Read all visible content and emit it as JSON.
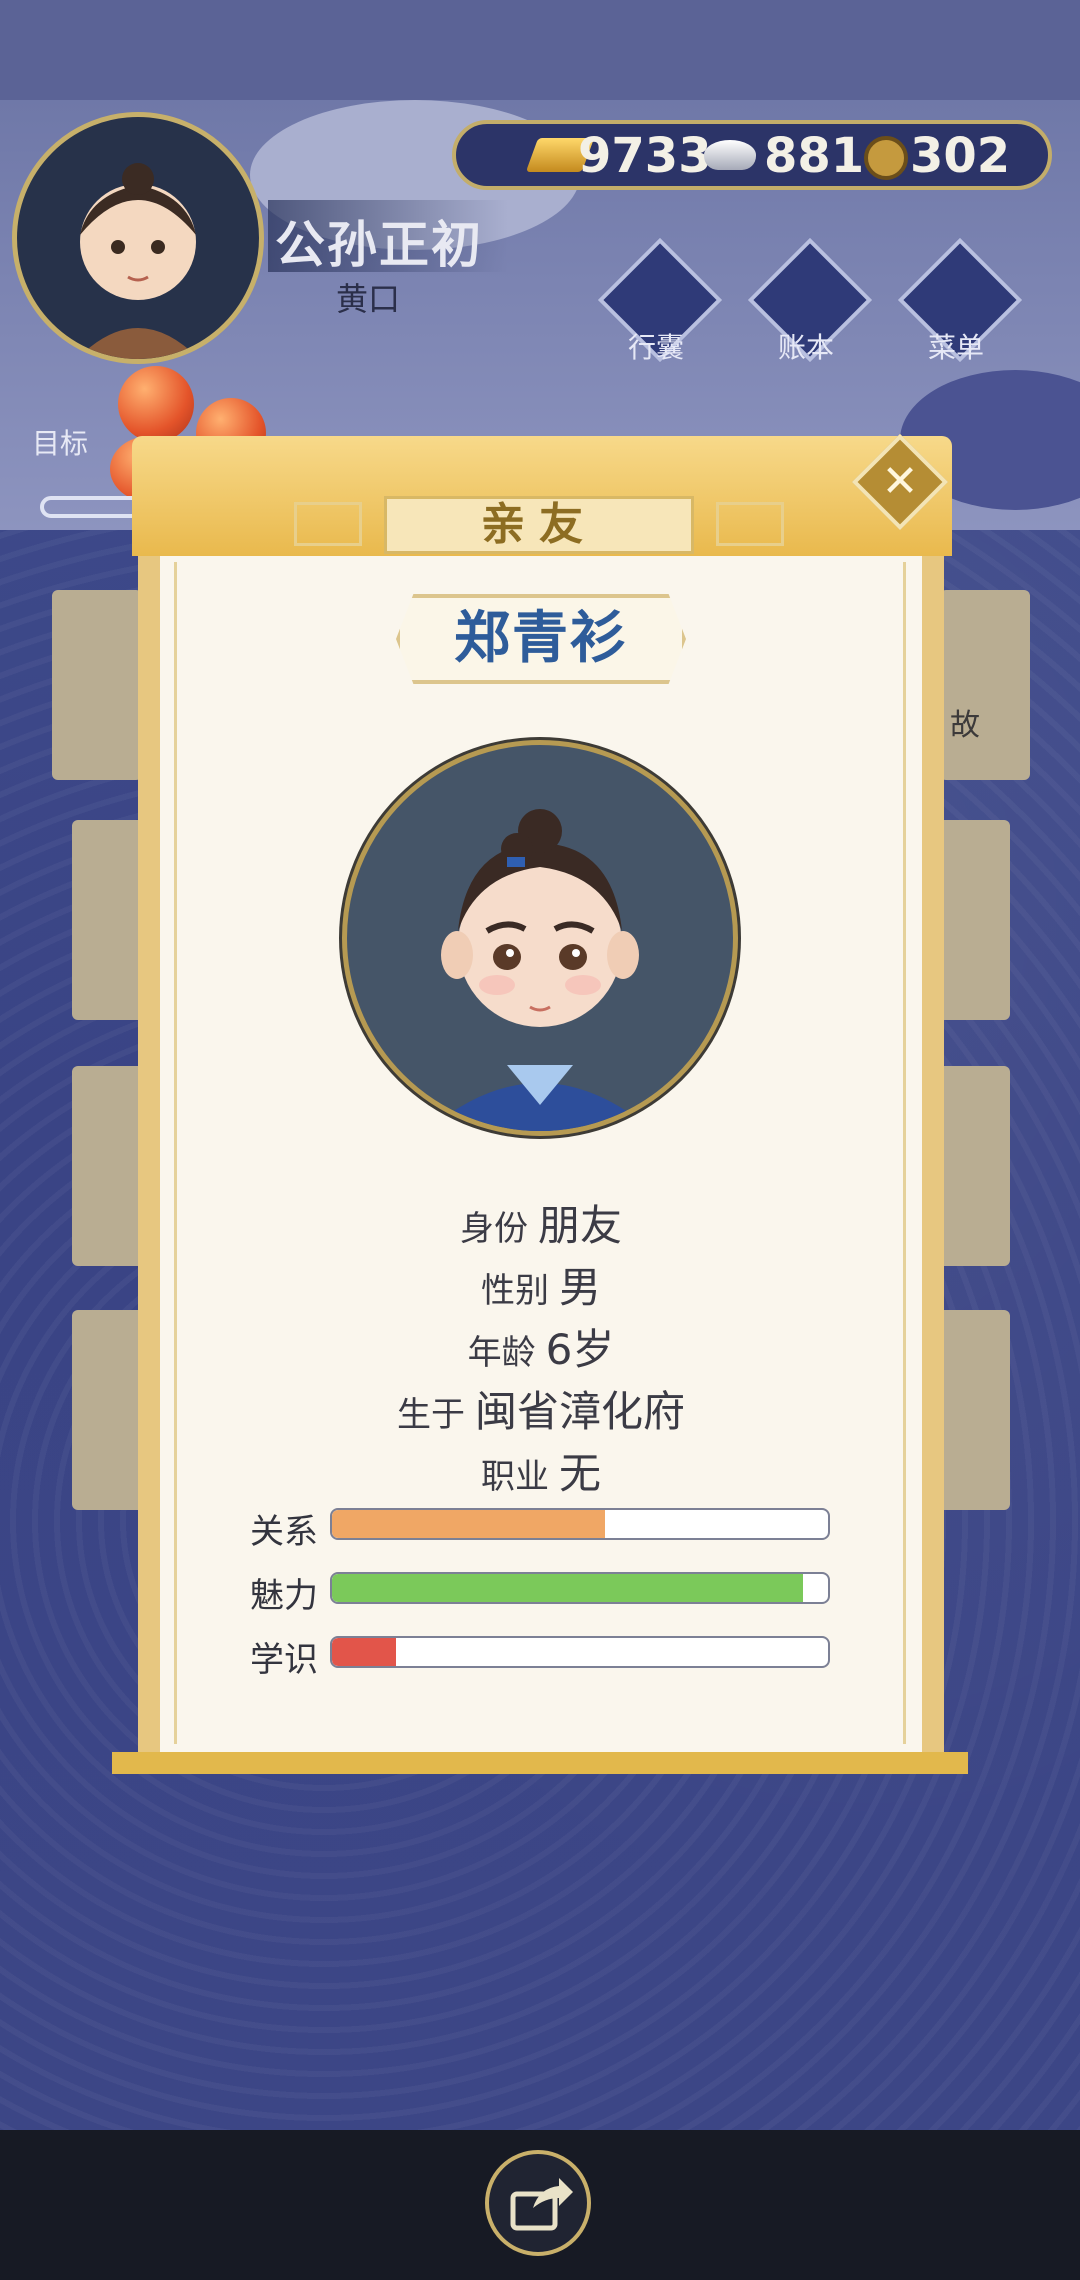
{
  "resources": {
    "gold": "9733",
    "silver": "881",
    "coins": "302"
  },
  "player": {
    "name": "公孙正初",
    "title": "黄口"
  },
  "menu": [
    {
      "label": "行囊"
    },
    {
      "label": "账本"
    },
    {
      "label": "菜单"
    }
  ],
  "goal_label": "目标",
  "bg_card_text": "故",
  "modal": {
    "header": "亲友",
    "close_symbol": "✕",
    "name": "郑青衫",
    "info": [
      {
        "label": "身份",
        "value": "朋友"
      },
      {
        "label": "性别",
        "value": "男"
      },
      {
        "label": "年龄",
        "value": "6岁"
      },
      {
        "label": "生于",
        "value": "闽省漳化府"
      },
      {
        "label": "职业",
        "value": "无"
      }
    ],
    "stats": [
      {
        "label": "关系",
        "value": 0.55,
        "color": "#f0a765"
      },
      {
        "label": "魅力",
        "value": 0.95,
        "color": "#7bc95a"
      },
      {
        "label": "学识",
        "value": 0.13,
        "color": "#e2554a"
      }
    ]
  },
  "colors": {
    "accent_gold": "#c9b06a",
    "name_blue": "#2e5c9a"
  }
}
